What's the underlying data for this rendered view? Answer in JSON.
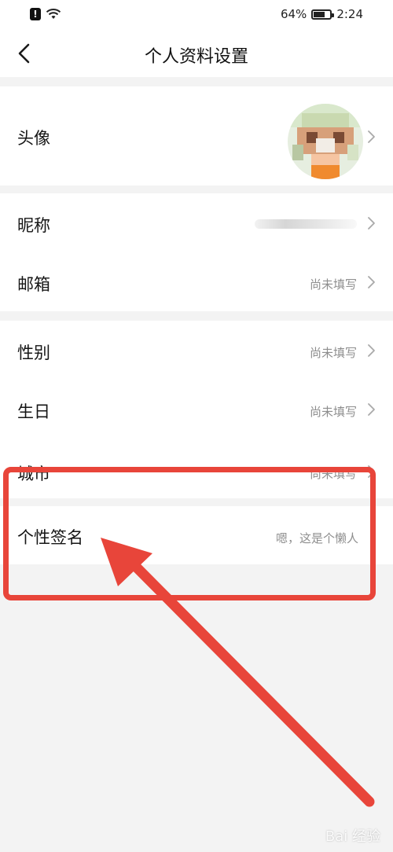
{
  "status_bar": {
    "battery": "64%",
    "time": "2:24"
  },
  "header": {
    "title": "个人资料设置"
  },
  "rows": {
    "avatar": {
      "label": "头像"
    },
    "nickname": {
      "label": "昵称"
    },
    "email": {
      "label": "邮箱",
      "value": "尚未填写"
    },
    "gender": {
      "label": "性别",
      "value": "尚未填写"
    },
    "birthday": {
      "label": "生日",
      "value": "尚未填写"
    },
    "city": {
      "label": "城市",
      "value": "尚未填写"
    },
    "signature": {
      "label": "个性签名",
      "value": "嗯，这是个懒人"
    }
  },
  "annotation": {
    "color": "#e8453a"
  },
  "watermark": {
    "text": "Bai 经验"
  }
}
